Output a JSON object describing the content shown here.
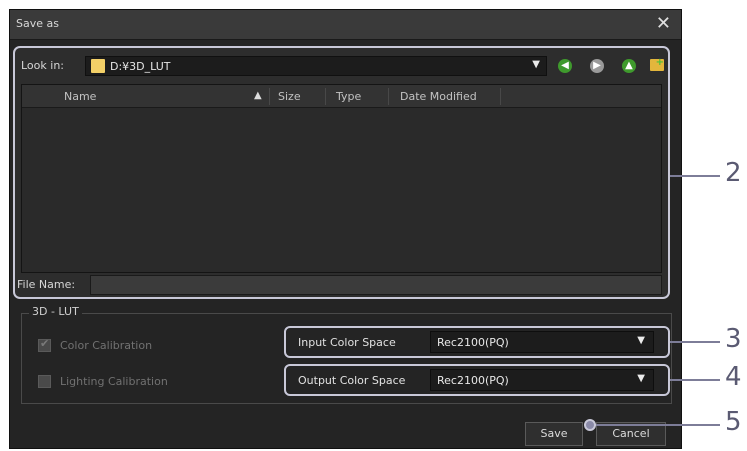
{
  "dialog": {
    "title": "Save as",
    "close_glyph": "✕"
  },
  "look_in": {
    "label": "Look in:",
    "path": "D:¥3D_LUT",
    "icon": "folder-icon",
    "dropdown_glyph": "▼"
  },
  "nav": {
    "back_glyph": "◀",
    "forward_glyph": "▶",
    "up_glyph": "▲"
  },
  "file_list": {
    "columns": [
      "Name",
      "Size",
      "Type",
      "Date Modified"
    ],
    "sort_glyph": "▲"
  },
  "file_name": {
    "label": "File Name:",
    "value": ""
  },
  "lut_group": {
    "title": "3D - LUT",
    "color_calibration": {
      "label": "Color Calibration",
      "checked": true
    },
    "lighting_calibration": {
      "label": "Lighting Calibration",
      "checked": false
    }
  },
  "input_color_space": {
    "label": "Input Color Space",
    "value": "Rec2100(PQ)",
    "dropdown_glyph": "▼"
  },
  "output_color_space": {
    "label": "Output Color Space",
    "value": "Rec2100(PQ)",
    "dropdown_glyph": "▼"
  },
  "buttons": {
    "save": "Save",
    "cancel": "Cancel"
  },
  "callouts": [
    "2",
    "3",
    "4",
    "5"
  ]
}
